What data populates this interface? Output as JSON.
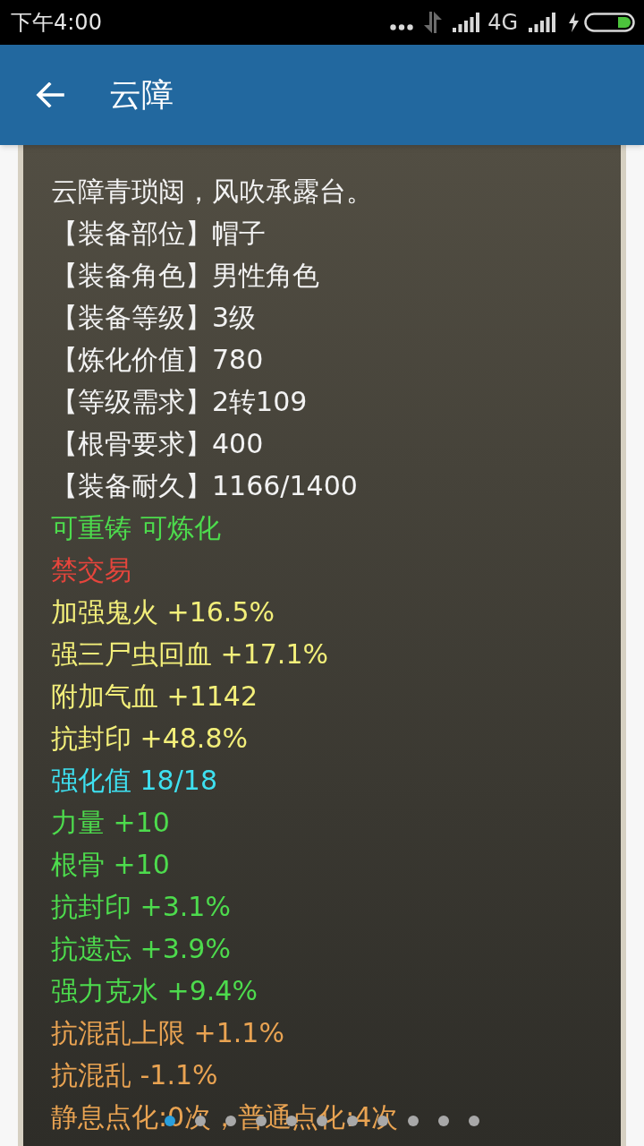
{
  "status_bar": {
    "time": "下午4:00",
    "network": "4G"
  },
  "header": {
    "title": "云障"
  },
  "lines": [
    {
      "text": "云障青琐闼，风吹承露台。",
      "color": "#f2f2f2"
    },
    {
      "text": "【装备部位】帽子",
      "color": "#f2f2f2"
    },
    {
      "text": "【装备角色】男性角色",
      "color": "#f2f2f2"
    },
    {
      "text": "【装备等级】3级",
      "color": "#f2f2f2"
    },
    {
      "text": "【炼化价值】780",
      "color": "#f2f2f2"
    },
    {
      "text": "【等级需求】2转109",
      "color": "#f2f2f2"
    },
    {
      "text": "【根骨要求】400",
      "color": "#f2f2f2"
    },
    {
      "text": "【装备耐久】1166/1400",
      "color": "#f2f2f2"
    },
    {
      "text": "可重铸 可炼化",
      "color": "#4ddb4d"
    },
    {
      "text": "禁交易",
      "color": "#e6453c"
    },
    {
      "text": "加强鬼火 +16.5%",
      "color": "#f3ef7a"
    },
    {
      "text": "强三尸虫回血 +17.1%",
      "color": "#f3ef7a"
    },
    {
      "text": "附加气血 +1142",
      "color": "#f3ef7a"
    },
    {
      "text": "抗封印 +48.8%",
      "color": "#f3ef7a"
    },
    {
      "text": "强化值 18/18",
      "color": "#3ee0f0"
    },
    {
      "text": "力量 +10",
      "color": "#4ddb4d"
    },
    {
      "text": "根骨 +10",
      "color": "#4ddb4d"
    },
    {
      "text": "抗封印 +3.1%",
      "color": "#4ddb4d"
    },
    {
      "text": "抗遗忘 +3.9%",
      "color": "#4ddb4d"
    },
    {
      "text": "强力克水 +9.4%",
      "color": "#4ddb4d"
    },
    {
      "text": "抗混乱上限 +1.1%",
      "color": "#e9a352"
    },
    {
      "text": "抗混乱 -1.1%",
      "color": "#e9a352"
    },
    {
      "text": "静息点化:0次，普通点化:4次",
      "color": "#e9a352"
    }
  ],
  "pager": [
    {
      "selected": true
    },
    {
      "selected": false
    },
    {
      "selected": false
    },
    {
      "selected": false
    },
    {
      "selected": false
    },
    {
      "selected": false
    },
    {
      "selected": false
    },
    {
      "selected": false
    },
    {
      "selected": false
    },
    {
      "selected": false
    },
    {
      "selected": false
    }
  ]
}
